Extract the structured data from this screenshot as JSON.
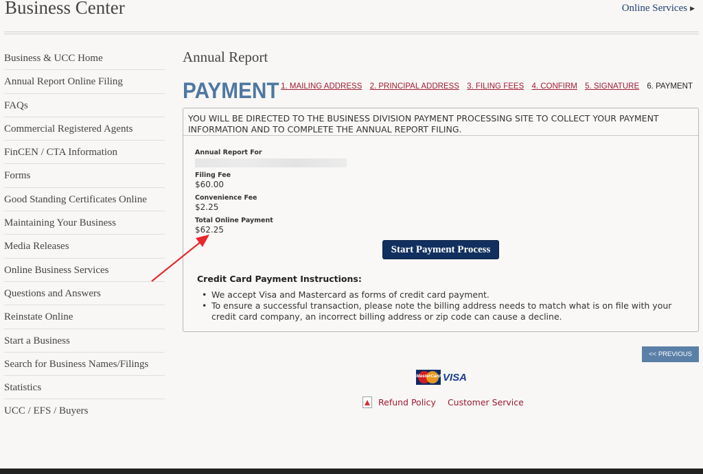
{
  "header": {
    "site_title": "Business Center",
    "online_services_label": "Online Services"
  },
  "sidebar": {
    "items": [
      {
        "label": "Business & UCC Home"
      },
      {
        "label": "Annual Report Online Filing"
      },
      {
        "label": "FAQs"
      },
      {
        "label": "Commercial Registered Agents"
      },
      {
        "label": "FinCEN / CTA Information"
      },
      {
        "label": "Forms"
      },
      {
        "label": "Good Standing Certificates Online"
      },
      {
        "label": "Maintaining Your Business"
      },
      {
        "label": "Media Releases"
      },
      {
        "label": "Online Business Services"
      },
      {
        "label": "Questions and Answers"
      },
      {
        "label": "Reinstate Online"
      },
      {
        "label": "Start a Business"
      },
      {
        "label": "Search for Business Names/Filings"
      },
      {
        "label": "Statistics"
      },
      {
        "label": "UCC / EFS / Buyers"
      }
    ]
  },
  "main": {
    "section_title": "Annual Report",
    "page_heading": "PAYMENT",
    "steps": [
      {
        "label": "1. MAILING ADDRESS"
      },
      {
        "label": "2. PRINCIPAL ADDRESS"
      },
      {
        "label": "3. FILING FEES"
      },
      {
        "label": "4. CONFIRM"
      },
      {
        "label": "5. SIGNATURE"
      },
      {
        "label": "6. PAYMENT"
      }
    ],
    "notice": "YOU WILL BE DIRECTED TO THE BUSINESS DIVISION PAYMENT PROCESSING SITE TO COLLECT YOUR PAYMENT INFORMATION AND TO COMPLETE THE ANNUAL REPORT FILING.",
    "annual_report_for_label": "Annual Report For",
    "filing_fee_label": "Filing Fee",
    "filing_fee_value": "$60.00",
    "convenience_fee_label": "Convenience Fee",
    "convenience_fee_value": "$2.25",
    "total_label": "Total Online Payment",
    "total_value": "$62.25",
    "start_payment_label": "Start Payment Process",
    "cc_instructions_title": "Credit Card Payment Instructions:",
    "cc_instructions": [
      "We accept Visa and Mastercard as forms of credit card payment.",
      "To ensure a successful transaction, please note the billing address needs to match what is on file with your credit card company, an incorrect billing address or zip code can cause a decline."
    ],
    "previous_label": "<< PREVIOUS"
  },
  "footer": {
    "mastercard_logo_text": "MasterCard",
    "visa_logo_text": "VISA",
    "refund_policy_label": "Refund Policy",
    "customer_service_label": "Customer Service"
  },
  "colors": {
    "heading_blue": "#4e78a2",
    "link_red": "#a01b32",
    "button_navy": "#12305f",
    "annotation_arrow": "#e8262b"
  },
  "icons": [
    "chevron-right-icon",
    "pdf-icon",
    "mastercard-logo",
    "visa-logo",
    "annotation-arrow"
  ]
}
